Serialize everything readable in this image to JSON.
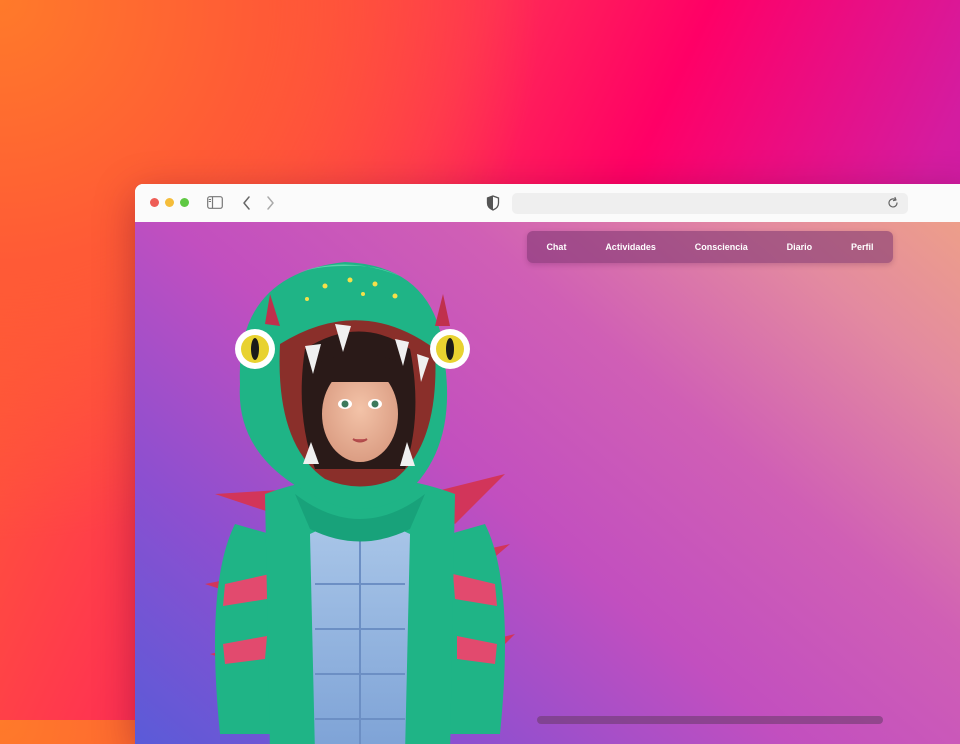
{
  "browser": {
    "address": "",
    "icons": {
      "sidebar": "sidebar-icon",
      "back": "chevron-left-icon",
      "forward": "chevron-right-icon",
      "privacy": "shield-icon",
      "reload": "reload-icon"
    }
  },
  "nav": {
    "items": [
      {
        "label": "Chat"
      },
      {
        "label": "Actividades"
      },
      {
        "label": "Consciencia"
      },
      {
        "label": "Diario"
      },
      {
        "label": "Perfil"
      }
    ]
  },
  "colors": {
    "backdrop_start": "#ff6a2b",
    "backdrop_mid": "#ff0066",
    "backdrop_end": "#b71bb5",
    "viewport_left": "#5a5bd8",
    "viewport_mid": "#c24fbf",
    "viewport_right": "#eea088",
    "avatar_costume": "#1fb486"
  }
}
